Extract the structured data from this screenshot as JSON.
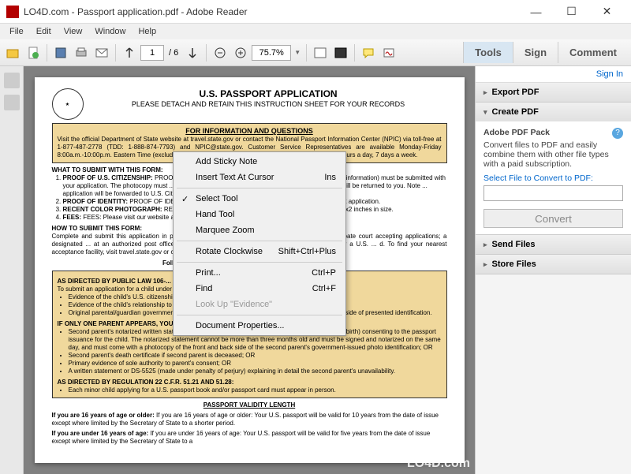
{
  "window": {
    "title": "LO4D.com - Passport application.pdf - Adobe Reader",
    "min": "—",
    "max": "☐",
    "close": "✕"
  },
  "menu": [
    "File",
    "Edit",
    "View",
    "Window",
    "Help"
  ],
  "toolbar": {
    "page_current": "1",
    "page_total": "/ 6",
    "zoom": "75.7%",
    "tabs": {
      "tools": "Tools",
      "sign": "Sign",
      "comment": "Comment"
    }
  },
  "rightPanel": {
    "signin": "Sign In",
    "export": "Export PDF",
    "create": "Create PDF",
    "create_body_title": "Adobe PDF Pack",
    "create_body_desc": "Convert files to PDF and easily combine them with other file types with a paid subscription.",
    "select_label": "Select File to Convert to PDF:",
    "convert_btn": "Convert",
    "send": "Send Files",
    "store": "Store Files"
  },
  "contextMenu": {
    "addSticky": "Add Sticky Note",
    "insertText": "Insert Text At Cursor",
    "insertText_sc": "Ins",
    "selectTool": "Select Tool",
    "handTool": "Hand Tool",
    "marqueeZoom": "Marquee Zoom",
    "rotateCW": "Rotate Clockwise",
    "rotateCW_sc": "Shift+Ctrl+Plus",
    "print": "Print...",
    "print_sc": "Ctrl+P",
    "find": "Find",
    "find_sc": "Ctrl+F",
    "lookup": "Look Up \"Evidence\"",
    "docProps": "Document Properties..."
  },
  "doc": {
    "title": "U.S. PASSPORT APPLICATION",
    "subtitle": "PLEASE DETACH AND RETAIN THIS INSTRUCTION SHEET FOR YOUR RECORDS",
    "info_h": "FOR INFORMATION AND QUESTIONS",
    "info_body": "Visit the official Department of State website at travel.state.gov or contact the National Passport Information Center (NPIC) via toll-free at 1-877-487-2778 (TDD: 1-888-874-7793) and NPIC@state.gov.  Customer Service Representatives are available Monday-Friday 8:00a.m.-10:00p.m. Eastern Time (excluding federal holidays). Automated information is available 24 hours a day, 7 days a week.",
    "what_h": "WHAT TO SUBMIT WITH THIS FORM:",
    "what_1": "PROOF OF U.S. CITIZENSHIP: Evidence ... back, if there is printed information) must be submitted with your application. The photocopy must ... and clear. Evidence that is not damaged, altered, or forged will be returned to you. Note ... application will be forwarded to U.S. Citizenship and Immigration Services, if we determine that ...",
    "what_2": "PROOF OF IDENTITY: You must present ... front and back with your passport application.",
    "what_3": "RECENT COLOR PHOTOGRAPH: Photograph ... the face and 2x2 inches in size.",
    "what_4": "FEES: Please visit our website at travel...",
    "how_h": "HOW TO SUBMIT THIS FORM:",
    "how_body": "Complete and submit this application in person ... state court of record or a judge or clerk of a probate court accepting applications; a designated ... at an authorized post office; an agent at a passport agency (by appointment only); or a U.S. ... d.  To find your nearest acceptance facility, visit travel.state.gov or contact the National P...",
    "follow": "Follow the instructions on ... and submission of this form.",
    "law_h": "AS DIRECTED BY PUBLIC LAW 106-...",
    "law_line": "To submit an application for a child under ... must appear and present the following:",
    "law_b1": "Evidence of the child's U.S. citizenship;",
    "law_b2": "Evidence of the child's relationship to parent(s)/guardian(s); AND",
    "law_b3": "Original parental/guardian government-issued identification AND a photocopy of the front and back side of presented identification.",
    "one_h": "IF ONLY ONE PARENT APPEARS, YOU MUST ALSO SUBMIT ONE OF THE FOLLOWING:",
    "one_b1": "Second parent's notarized written statement or DS-3053 (including the child's full name and date of birth) consenting to the passport issuance for the child. The notarized statement cannot be more than three months old and must be signed and notarized on the same day, and must come with a photocopy of the front and back side of the second parent's government-issued photo identification; OR",
    "one_b2": "Second parent's death certificate if second parent is deceased; OR",
    "one_b3": "Primary evidence of sole authority to parent's consent; OR",
    "one_b4": "A written statement or DS-5525 (made under penalty of perjury) explaining in detail the second parent's unavailability.",
    "reg_h": "AS DIRECTED BY REGULATION 22 C.F.R. 51.21 AND 51.28:",
    "reg_b1": "Each minor child applying for a U.S. passport book and/or passport card must appear in person.",
    "validity_h": "PASSPORT VALIDITY LENGTH",
    "validity_16o": "If you are 16 years of age or older: Your U.S. passport will be valid for 10 years from the date of issue except where limited by the Secretary of State to a shorter period.",
    "validity_16u": "If you are under 16 years of age: Your U.S. passport will be valid for five years from the date of issue except where limited by the Secretary of State to a"
  },
  "watermark": "LO4D.com"
}
